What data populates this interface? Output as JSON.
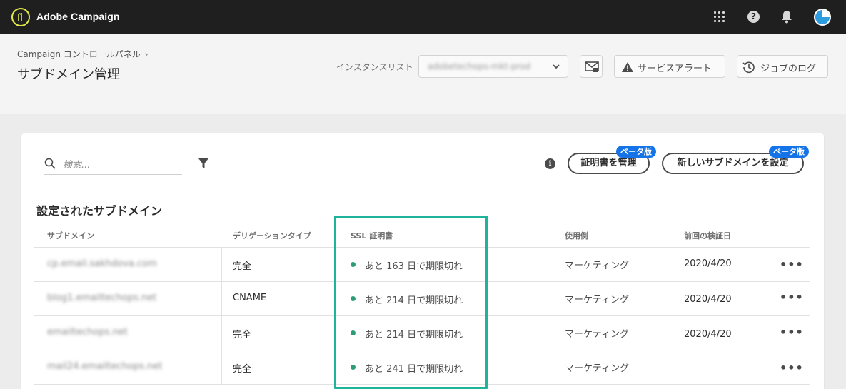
{
  "topbar": {
    "app_title": "Adobe Campaign",
    "icons": [
      "adobe-campaign-logo",
      "apps-grid-icon",
      "help-icon",
      "bell-icon",
      "avatar"
    ]
  },
  "header": {
    "breadcrumb": "Campaign コントロールパネル",
    "page_title": "サブドメイン管理",
    "instance_label": "インスタンスリスト",
    "instance_value": "adobetechops-mkt-prod",
    "service_alert_label": "サービスアラート",
    "job_log_label": "ジョブのログ"
  },
  "toolbar": {
    "search_placeholder": "検索...",
    "manage_cert_label": "証明書を管理",
    "new_subdomain_label": "新しいサブドメインを設定",
    "beta_badge": "ベータ版"
  },
  "section_title": "設定されたサブドメイン",
  "table": {
    "columns": [
      "サブドメイン",
      "デリゲーションタイプ",
      "SSL 証明書",
      "使用例",
      "前回の検証日"
    ],
    "rows": [
      {
        "subdomain": "cp.email.sakhdova.com",
        "delegation": "完全",
        "ssl": "あと 163 日で期限切れ",
        "use_case": "マーケティング",
        "last_verified": "2020/4/20"
      },
      {
        "subdomain": "blog1.emailtechops.net",
        "delegation": "CNAME",
        "ssl": "あと 214 日で期限切れ",
        "use_case": "マーケティング",
        "last_verified": "2020/4/20"
      },
      {
        "subdomain": "emailtechops.net",
        "delegation": "完全",
        "ssl": "あと 214 日で期限切れ",
        "use_case": "マーケティング",
        "last_verified": "2020/4/20"
      },
      {
        "subdomain": "mail24.emailtechops.net",
        "delegation": "完全",
        "ssl": "あと 241 日で期限切れ",
        "use_case": "マーケティング",
        "last_verified": ""
      }
    ],
    "row_more": "•••"
  },
  "colors": {
    "topbar": "#1f1f1f",
    "status_green": "#2d9d78",
    "highlight": "#1eb39a",
    "beta_blue": "#1473e6"
  }
}
